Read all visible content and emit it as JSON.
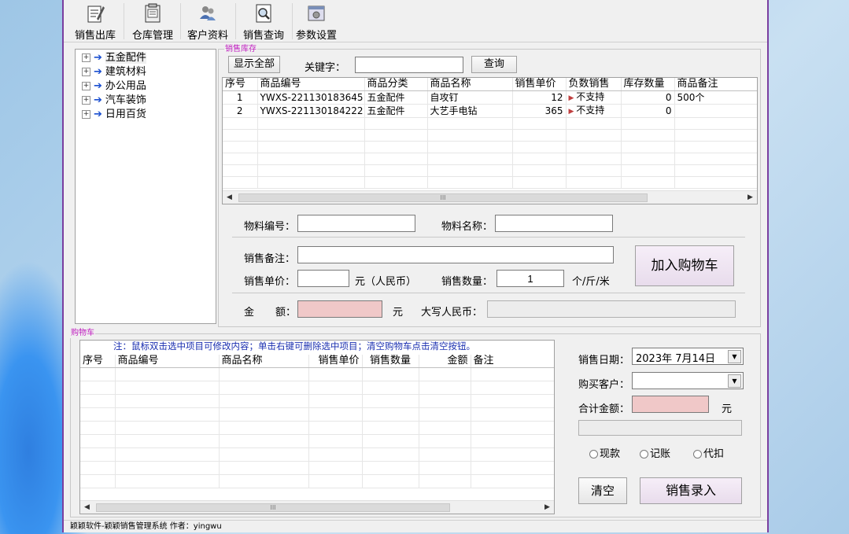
{
  "toolbar": {
    "items": [
      {
        "label": "销售出库",
        "icon": "sales-out-icon"
      },
      {
        "label": "仓库管理",
        "icon": "warehouse-icon"
      },
      {
        "label": "客户资料",
        "icon": "customers-icon"
      },
      {
        "label": "销售查询",
        "icon": "search-doc-icon"
      },
      {
        "label": "参数设置",
        "icon": "settings-icon"
      }
    ]
  },
  "tree": {
    "items": [
      "五金配件",
      "建筑材料",
      "办公用品",
      "汽车装饰",
      "日用百货"
    ]
  },
  "inventory": {
    "group_title": "销售库存",
    "show_all_label": "显示全部",
    "keyword_label": "关键字：",
    "keyword_value": "",
    "query_label": "查询",
    "columns": [
      "序号",
      "商品编号",
      "商品分类",
      "商品名称",
      "销售单价",
      "负数销售",
      "库存数量",
      "商品备注"
    ],
    "rows": [
      {
        "no": "1",
        "code": "YWXS-221130183645",
        "category": "五金配件",
        "name": "自攻钉",
        "price": "12",
        "negative": "不支持",
        "stock": "0",
        "note": "500个"
      },
      {
        "no": "2",
        "code": "YWXS-221130184222",
        "category": "五金配件",
        "name": "大艺手电钻",
        "price": "365",
        "negative": "不支持",
        "stock": "0",
        "note": ""
      }
    ],
    "scroll_mark": "III"
  },
  "form": {
    "item_code_label": "物料编号：",
    "item_code_value": "",
    "item_name_label": "物料名称：",
    "item_name_value": "",
    "remark_label": "销售备注：",
    "remark_value": "",
    "unit_price_label": "销售单价：",
    "unit_price_value": "",
    "currency_label": "元（人民币）",
    "qty_label": "销售数量：",
    "qty_value": "1",
    "unit_label": "个/斤/米",
    "add_cart_label": "加入购物车",
    "amount_label_a": "金",
    "amount_label_b": "额：",
    "amount_value": "",
    "yuan_label": "元",
    "rmb_caps_label": "大写人民币：",
    "rmb_caps_value": ""
  },
  "cart": {
    "group_title": "购物车",
    "notice": "注：鼠标双击选中项目可修改内容；单击右键可删除选中项目；清空购物车点击清空按钮。",
    "columns": [
      "序号",
      "商品编号",
      "商品名称",
      "销售单价",
      "销售数量",
      "金额",
      "备注"
    ],
    "scroll_mark": "III"
  },
  "summary": {
    "date_label": "销售日期：",
    "date_value": "2023年  7月14日",
    "customer_label": "购买客户：",
    "customer_value": "",
    "total_label": "合计金额：",
    "total_value": "",
    "total_unit": "元",
    "caps_value": "",
    "pay_options": [
      "现款",
      "记账",
      "代扣"
    ],
    "clear_label": "清空",
    "submit_label": "销售录入"
  },
  "status_bar": "颖颖软件-颖颖销售管理系统 作者：yingwu",
  "colors": {
    "window_border": "#7a3fa0",
    "group_title": "#c020c0",
    "amount_bg": "#f0c8c8",
    "tree_arrow": "#1a4fd0"
  }
}
